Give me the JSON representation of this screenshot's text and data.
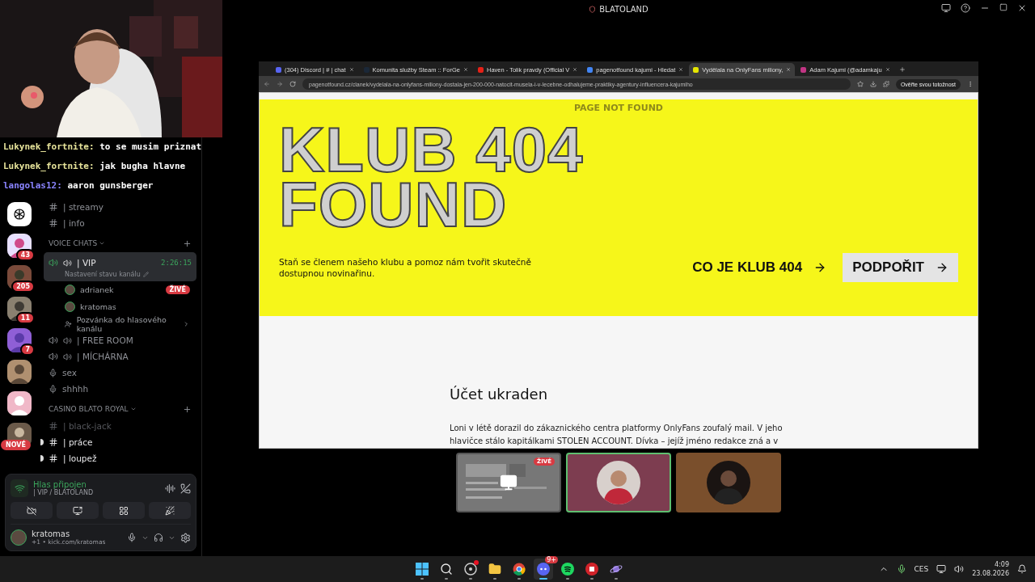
{
  "stage_title": "BLATOLAND",
  "chat_overlay": [
    {
      "user": "Lukynek_fortnite:",
      "color": "#e6e39a",
      "message": "to se musim priznat"
    },
    {
      "user": "Lukynek_fortnite:",
      "color": "#e6e39a",
      "message": "jak bugha hlavne"
    },
    {
      "user": "langolas12:",
      "color": "#8a84ff",
      "message": "aaron gunsberger"
    }
  ],
  "servers": [
    {
      "kind": "logo"
    },
    {
      "kind": "picture",
      "badge": "43"
    },
    {
      "kind": "picture",
      "badge": "205"
    },
    {
      "kind": "picture",
      "badge": "11"
    },
    {
      "kind": "picture",
      "badge": "7"
    },
    {
      "kind": "picture"
    },
    {
      "kind": "picture"
    },
    {
      "kind": "picture",
      "flag": "NOVÉ"
    }
  ],
  "channel_groups": [
    {
      "channels": [
        {
          "kind": "text",
          "name": "| streamy",
          "unread": false
        },
        {
          "kind": "text",
          "name": "| info",
          "unread": false
        }
      ]
    },
    {
      "title": "VOICE CHATS",
      "channels": [
        {
          "kind": "voice",
          "name": "| VIP",
          "connected": true,
          "selected": true,
          "timer": "2:26:15",
          "status": "Nastavení stavu kanálu",
          "members": [
            {
              "name": "adrianek",
              "badge": "ŽIVÉ"
            },
            {
              "name": "kratomas"
            }
          ],
          "invite": "Pozvánka do hlasového kanálu"
        },
        {
          "kind": "voice",
          "name": "| FREE ROOM",
          "connected": false,
          "selected": false
        },
        {
          "kind": "voice",
          "name": "| MÍCHÁRNA",
          "connected": false,
          "selected": false
        },
        {
          "kind": "stage",
          "name": "sex",
          "connected": false,
          "selected": false
        },
        {
          "kind": "stage",
          "name": "shhhh",
          "connected": false,
          "selected": false
        }
      ]
    },
    {
      "title": "CASINO BLATO ROYAL",
      "channels": [
        {
          "kind": "text",
          "name": "| black-jack",
          "unread": false
        },
        {
          "kind": "text",
          "name": "| práce",
          "unread": true
        },
        {
          "kind": "text",
          "name": "| loupež",
          "unread": true
        }
      ]
    }
  ],
  "voice_panel": {
    "status": "Hlas připojen",
    "channel": "| VIP / BLATOLAND"
  },
  "user_panel": {
    "name": "kratomas",
    "activity": "+1 • kick.com/kratomas"
  },
  "browser": {
    "tabs": [
      {
        "title": "(304) Discord | # | chat",
        "selected": false
      },
      {
        "title": "Komunita služby Steam :: ForGe",
        "selected": false
      },
      {
        "title": "Haven - Tolik pravdy (Official V",
        "selected": false
      },
      {
        "title": "pagenotfound kajumi - Hledat",
        "selected": false
      },
      {
        "title": "Vydělala na OnlyFans miliony, ",
        "selected": true
      },
      {
        "title": "Adam Kajumi (@adamkaju",
        "selected": false
      }
    ],
    "url": "pagenotfound.cz/clanek/vydelala-na-onlyfans-miliony-dostala-jen-200-000-natocit-musela-i-v-lecebne-odhalujeme-praktiky-agentury-influencera-kajumiho",
    "verify_button": "Ověřte svou totožnost",
    "page": {
      "site_title": "PAGE NOT FOUND",
      "headline": [
        "KLUB 404",
        "FOUND"
      ],
      "intro": "Staň se členem našeho klubu a pomoz nám tvořit skutečně dostupnou novinařinu.",
      "link": "CO JE KLUB 404",
      "button": "PODPOŘIT",
      "article_title": "Účet ukraden",
      "article_lines": [
        "Loni v létě dorazil do zákaznického centra platformy OnlyFans zoufalý mail. V jeho",
        "hlavičce stálo kapitálkami STOLEN ACCOUNT. Dívka – jejíž jméno redakce zná a v"
      ]
    }
  },
  "stage_tiles": [
    {
      "kind": "screen",
      "badge": "ŽIVÉ",
      "selected": false
    },
    {
      "kind": "avatar",
      "color": "#7d3d50",
      "selected": true
    },
    {
      "kind": "avatar",
      "color": "#7a4f2c",
      "selected": false
    }
  ],
  "taskbar": {
    "apps": [
      {
        "kind": "start",
        "active": false
      },
      {
        "kind": "search",
        "active": false
      },
      {
        "kind": "steam",
        "active": false,
        "dot": true
      },
      {
        "kind": "files",
        "active": false
      },
      {
        "kind": "browser",
        "active": false
      },
      {
        "kind": "chat",
        "active": true,
        "badge": "9+"
      },
      {
        "kind": "music",
        "active": false
      },
      {
        "kind": "game",
        "active": false
      },
      {
        "kind": "planet",
        "active": false
      }
    ],
    "language": "CES",
    "time": "4:09",
    "date": "23.08.2026"
  }
}
